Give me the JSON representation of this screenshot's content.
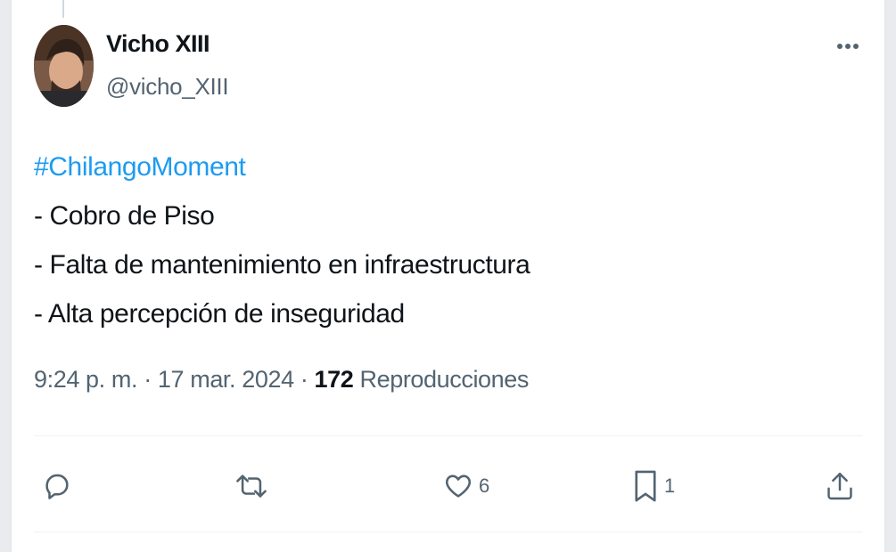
{
  "tweet": {
    "author_name": "Vicho XIII",
    "author_handle": "@vicho_XIII",
    "hashtag": "#ChilangoMoment",
    "lines": [
      "- Cobro de Piso",
      "- Falta de mantenimiento en infraestructura",
      "- Alta percepción de inseguridad"
    ],
    "time": "9:24 p. m.",
    "separator": "·",
    "date": "17 mar. 2024",
    "views_count": "172",
    "views_label": "Reproducciones"
  },
  "actions": {
    "reply_icon": "reply-icon",
    "retweet_icon": "retweet-icon",
    "like_icon": "heart-icon",
    "like_count": "6",
    "bookmark_icon": "bookmark-icon",
    "bookmark_count": "1",
    "share_icon": "share-icon",
    "more_icon": "more-icon"
  },
  "colors": {
    "link": "#1d9bf0",
    "text": "#0f1419",
    "secondary": "#536471"
  }
}
